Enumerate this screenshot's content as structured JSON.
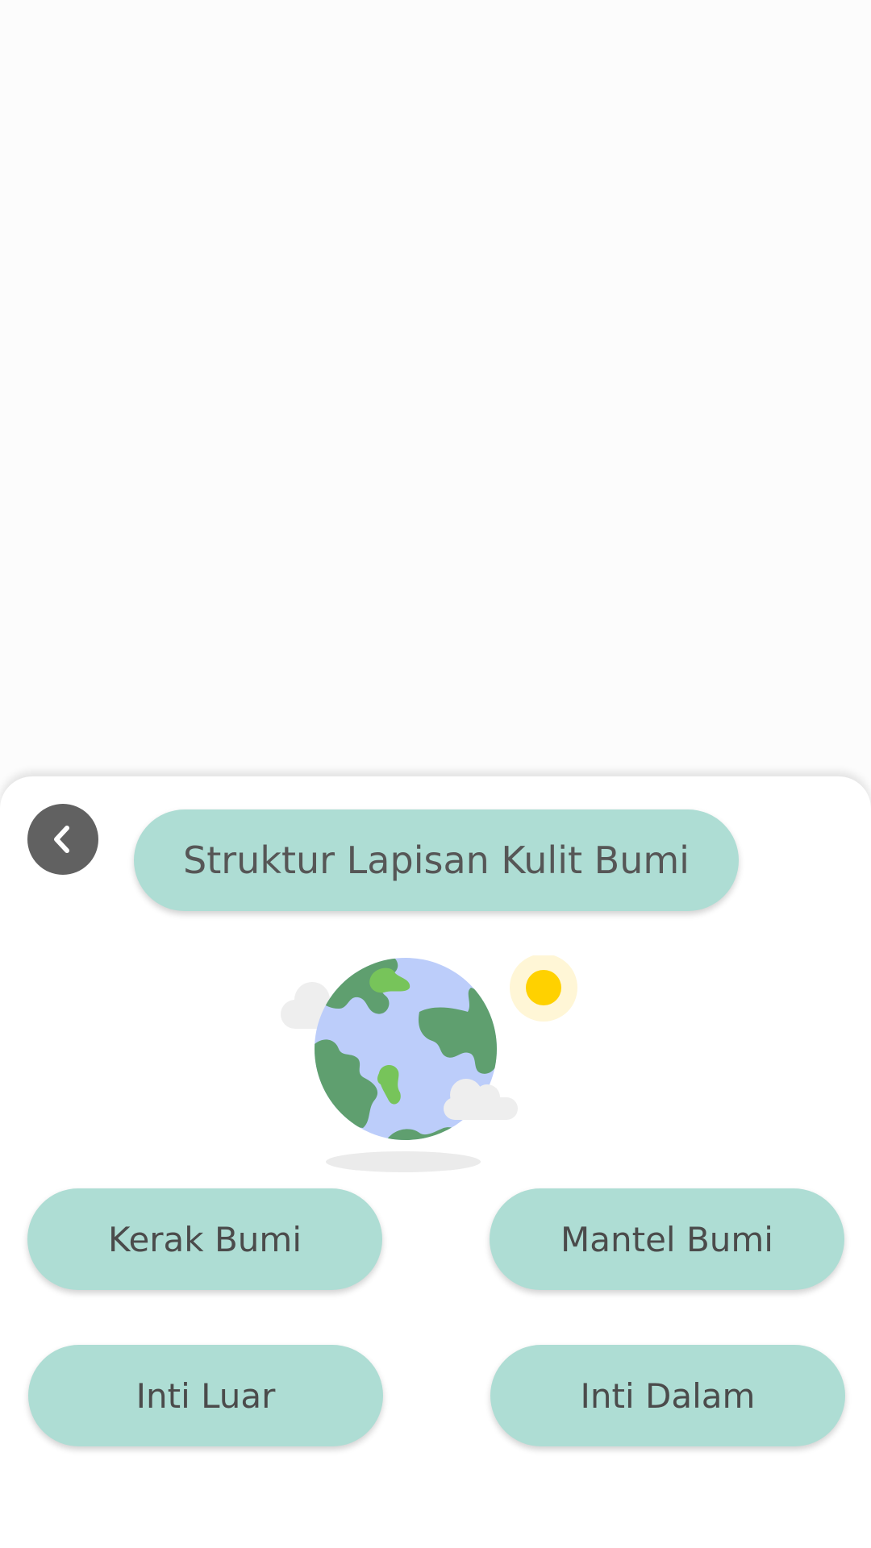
{
  "header": {
    "back_icon": "chevron-left-icon",
    "title": "Struktur Lapisan Kulit Bumi"
  },
  "illustration": {
    "icon": "globe-icon",
    "extras": [
      "cloud-icon",
      "sun-icon"
    ]
  },
  "options": [
    {
      "label": "Kerak Bumi"
    },
    {
      "label": "Mantel Bumi"
    },
    {
      "label": "Inti Luar"
    },
    {
      "label": "Inti Dalam"
    }
  ],
  "colors": {
    "button_fill": "#aeddd4",
    "back_button": "#616161",
    "text": "#4b4b4b",
    "globe_ocean": "#bccdfa",
    "globe_land": "#5f9f6f",
    "globe_land_light": "#77c45a",
    "sun": "#ffd100"
  }
}
